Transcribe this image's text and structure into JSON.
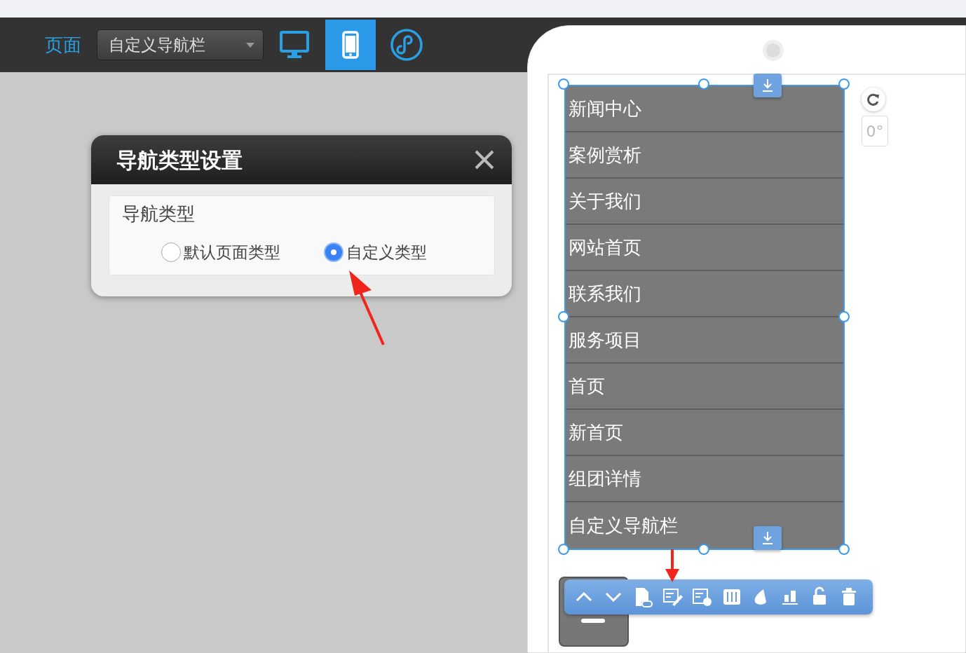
{
  "toolbar": {
    "page_label": "页面",
    "page_select": "自定义导航栏",
    "devices": [
      {
        "kind": "desktop",
        "selected": false
      },
      {
        "kind": "mobile",
        "selected": true
      },
      {
        "kind": "miniprogram",
        "selected": false
      }
    ]
  },
  "dialog": {
    "title": "导航类型设置",
    "group_label": "导航类型",
    "options": [
      {
        "label": "默认页面类型",
        "selected": false
      },
      {
        "label": "自定义类型",
        "selected": true
      }
    ]
  },
  "nav_widget": {
    "items": [
      "新闻中心",
      "案例赏析",
      "关于我们",
      "网站首页",
      "联系我们",
      "服务项目",
      "首页",
      "新首页",
      "组团详情",
      "自定义导航栏"
    ]
  },
  "rotation": {
    "angle": "0°"
  }
}
